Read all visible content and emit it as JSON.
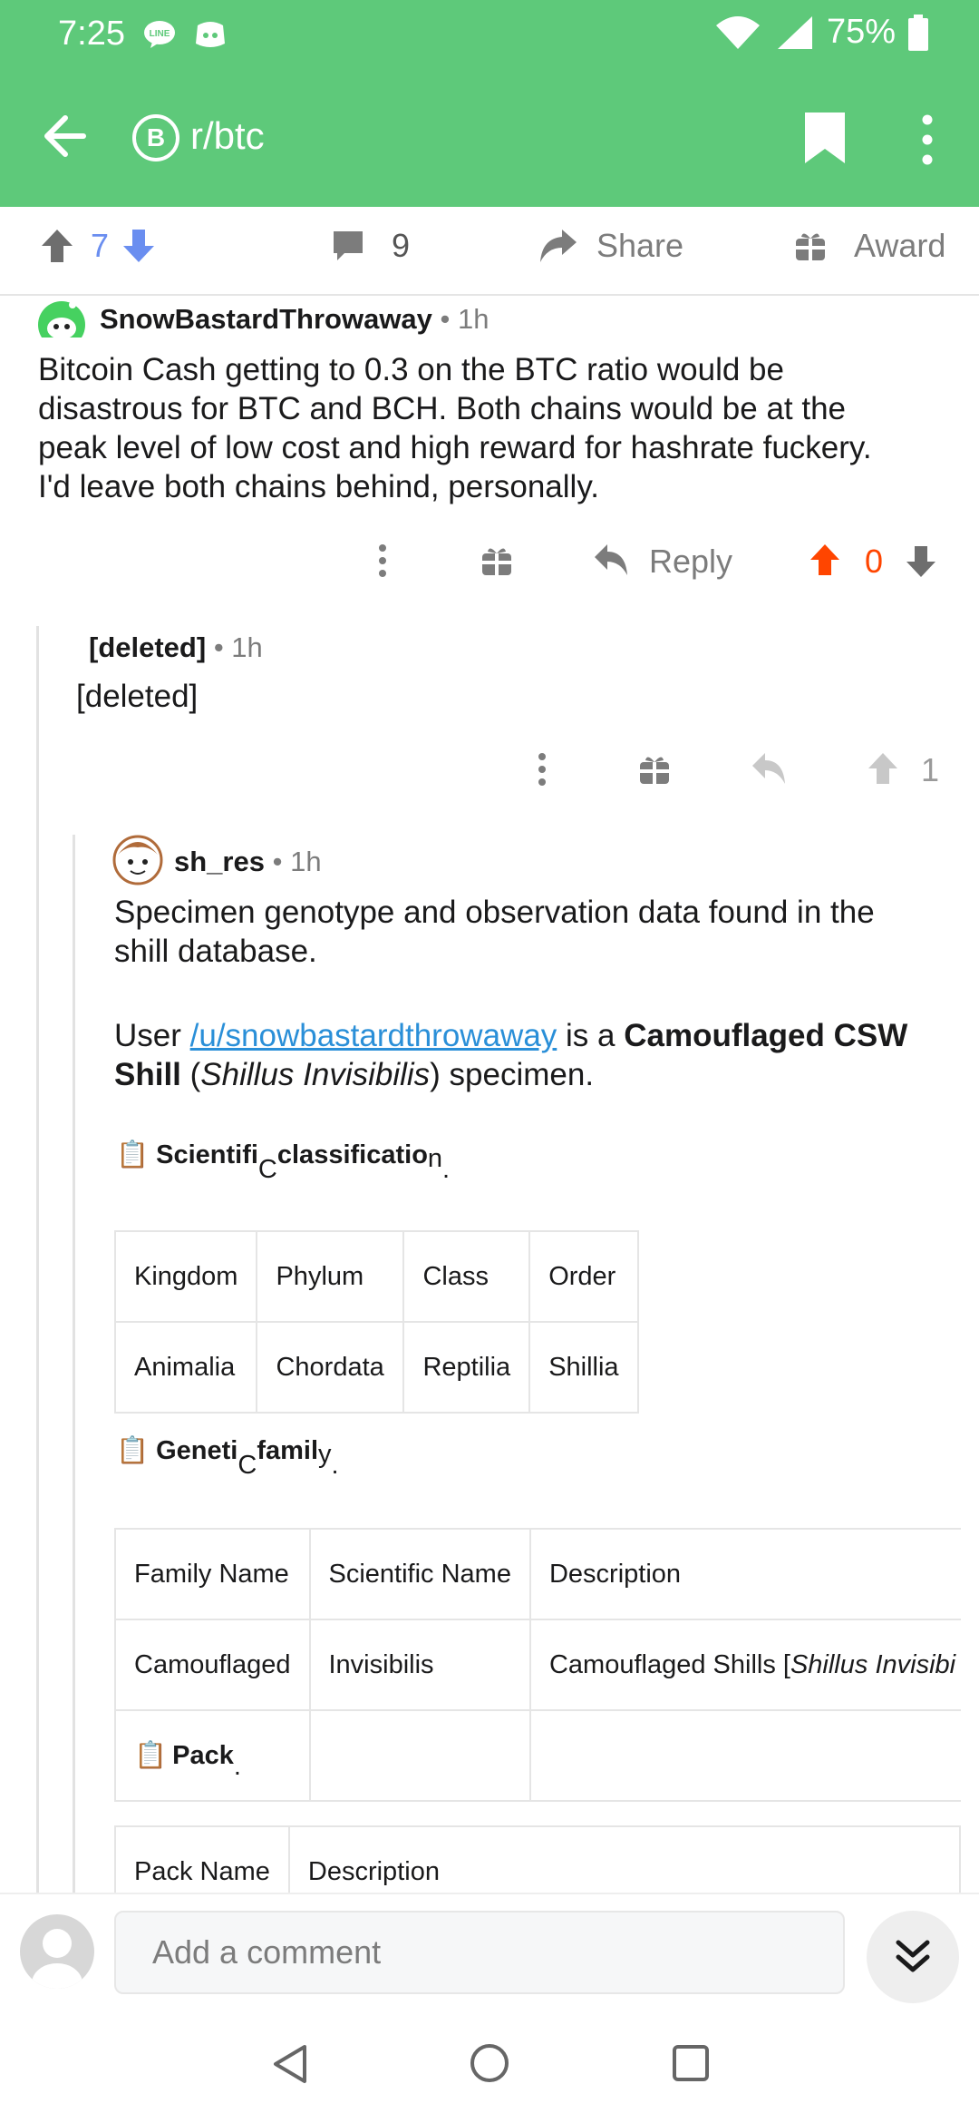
{
  "status_bar": {
    "time": "7:25",
    "battery": "75%"
  },
  "app_bar": {
    "subreddit": "r/btc",
    "badge": "B"
  },
  "action_bar": {
    "upvotes": "7",
    "comments": "9",
    "share": "Share",
    "award": "Award"
  },
  "comment1": {
    "author": "SnowBastardThrowaway",
    "separator": "•",
    "age": "1h",
    "body": [
      "Bitcoin Cash getting to 0.3 on the BTC ratio would be",
      "disastrous for BTC and BCH. Both chains would be at the",
      "peak level of low cost and high reward for hashrate fuckery.",
      "I'd leave both chains behind, personally."
    ],
    "reply": "Reply",
    "score": "0"
  },
  "comment2": {
    "author": "[deleted]",
    "separator": "•",
    "age": "1h",
    "body": "[deleted]",
    "score": "1"
  },
  "comment3": {
    "author": "sh_res",
    "separator": "•",
    "age": "1h",
    "intro": [
      "Specimen genotype and observation data found in the",
      "shill database."
    ],
    "user_prefix": "User ",
    "user_link": "/u/snowbastardthrowaway",
    "is_a": " is a ",
    "type_bold_1": "Camouflaged CSW",
    "type_bold_2": "Shill",
    "open_paren": " (",
    "species": "Shillus Invisibilis",
    "close_suffix": ") specimen.",
    "clip": "📋",
    "classification": {
      "head_main": "Scientifi",
      "head_sub": "C",
      "head_rest": " classificatio",
      "head_end": "n",
      "head_dot": "."
    },
    "class_table": {
      "headers": [
        "Kingdom",
        "Phylum",
        "Class",
        "Order"
      ],
      "row": [
        "Animalia",
        "Chordata",
        "Reptilia",
        "Shillia"
      ]
    },
    "genetic": {
      "head_main": "Geneti",
      "head_sub": "C",
      "head_rest": " famil",
      "head_end": "y",
      "head_dot": "."
    },
    "family_table": {
      "headers": [
        "Family Name",
        "Scientific Name",
        "Description"
      ],
      "row": [
        "Camouflaged",
        "Invisibilis",
        "Camouflaged Shills [",
        "Shillus Invisibi"
      ],
      "pack_label": "Pack",
      "pack_dot": "."
    },
    "pack_table": {
      "headers": [
        "Pack Name",
        "Description"
      ]
    }
  },
  "bottom_bar": {
    "placeholder": "Add a comment"
  },
  "colors": {
    "brand_green": "#5ec97a",
    "upvote_blue": "#6a8ef0",
    "orangered": "#ff4500",
    "link_blue": "#2a8fd8",
    "grey": "#7c7c7c"
  }
}
